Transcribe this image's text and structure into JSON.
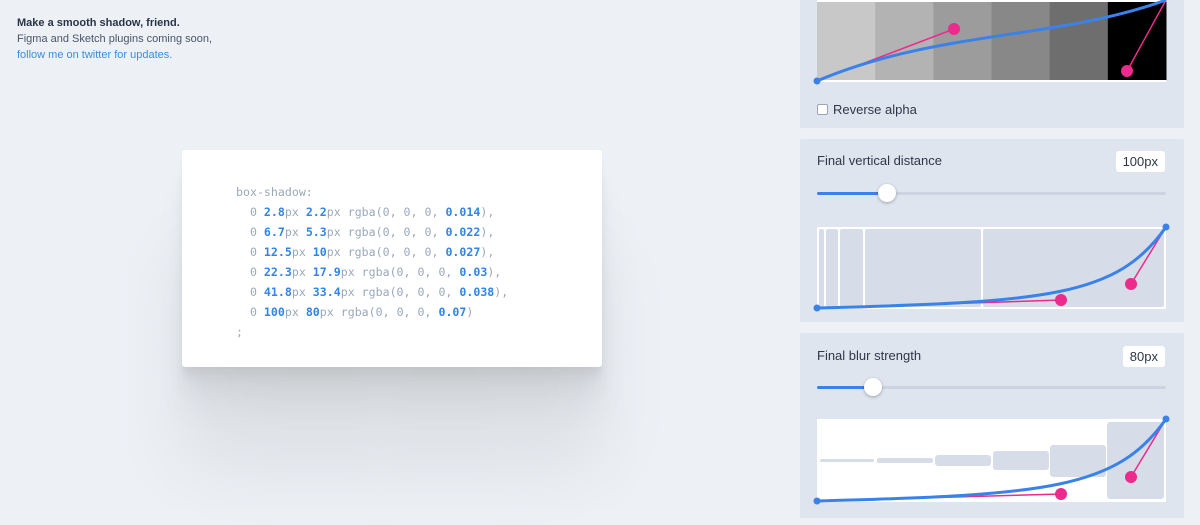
{
  "intro": {
    "title": "Make a smooth shadow, friend.",
    "line2": "Figma and Sketch plugins coming soon,",
    "link": "follow me on twitter for updates."
  },
  "code": {
    "property": "box-shadow:",
    "layers": [
      {
        "offset": "2.8",
        "blur": "2.2",
        "alpha": "0.014"
      },
      {
        "offset": "6.7",
        "blur": "5.3",
        "alpha": "0.022"
      },
      {
        "offset": "12.5",
        "blur": "10",
        "alpha": "0.027"
      },
      {
        "offset": "22.3",
        "blur": "17.9",
        "alpha": "0.03"
      },
      {
        "offset": "41.8",
        "blur": "33.4",
        "alpha": "0.038"
      },
      {
        "offset": "100",
        "blur": "80",
        "alpha": "0.07"
      }
    ],
    "terminator": ";"
  },
  "alpha_panel": {
    "reverse_label": "Reverse alpha",
    "reverse_checked": false,
    "swatch_colors": [
      "#c8c8c8",
      "#b3b3b3",
      "#9c9c9c",
      "#888888",
      "#6e6e6e",
      "#000000"
    ]
  },
  "distance_panel": {
    "label": "Final vertical distance",
    "value": "100px",
    "slider_fraction": 0.2
  },
  "blur_panel": {
    "label": "Final blur strength",
    "value": "80px",
    "slider_fraction": 0.16
  },
  "colors": {
    "accent": "#3b82e8",
    "control_point": "#ec2b8c",
    "code_number": "#2f86e6"
  }
}
